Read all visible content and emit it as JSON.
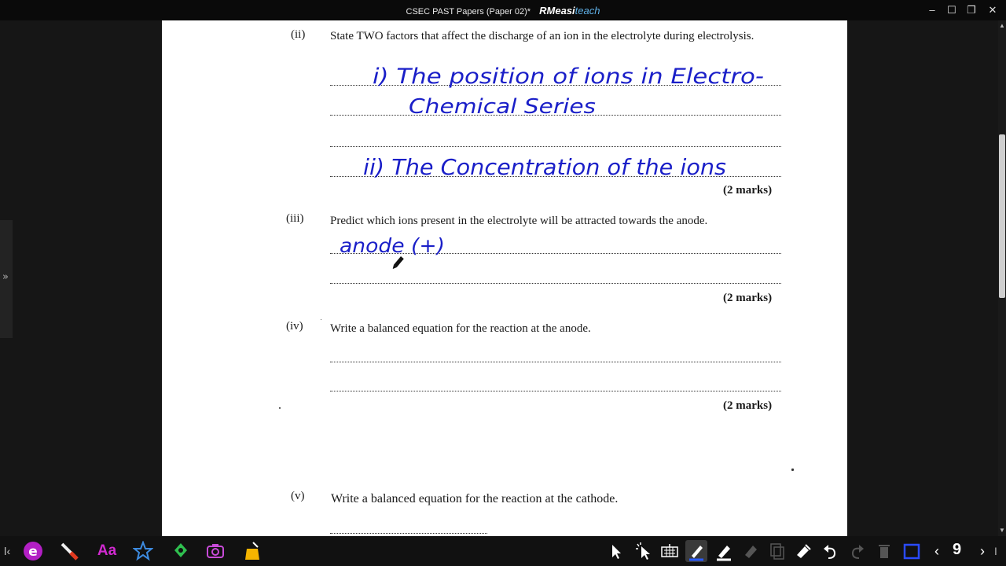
{
  "window": {
    "title": "CSEC PAST Papers (Paper 02)*",
    "brand_bold": "RMeasi",
    "brand_light": "teach",
    "minimize": "–",
    "maximize": "☐",
    "restore": "❐",
    "close": "✕"
  },
  "sidebar": {
    "handle_glyph": "»"
  },
  "paper": {
    "q2": {
      "num": "(ii)",
      "text": "State TWO factors that affect the discharge of an ion in the electrolyte during electrolysis.",
      "marks": "(2 marks)",
      "answer1_line1": "i) The position of ions in Electro-",
      "answer1_line2": "Chemical Series",
      "answer2": "ii) The Concentration of the ions"
    },
    "q3": {
      "num": "(iii)",
      "text": "Predict which ions present in the electrolyte will be attracted towards the anode.",
      "marks": "(2 marks)",
      "answer": "anode (+)"
    },
    "q4": {
      "num": "(iv)",
      "text": "Write a balanced equation for the reaction at the anode.",
      "marks": "(2 marks)"
    },
    "q5": {
      "num": "(v)",
      "text": "Write a balanced equation for the reaction at the cathode."
    }
  },
  "toolbar": {
    "left_arrow": "ǀ‹",
    "text_tool": "Aa",
    "page_number": "9",
    "icons": [
      "edge-icon",
      "marker-icon",
      "text-icon",
      "star-icon",
      "recycle-icon",
      "camera-icon",
      "shape-icon",
      "pointer-icon",
      "magic-pointer-icon",
      "keyboard-icon",
      "pen-icon",
      "highlighter-icon",
      "eraser-icon",
      "copy-icon",
      "fill-icon",
      "undo-icon",
      "redo-icon",
      "trash-icon",
      "rectangle-select-icon",
      "prev-page-icon",
      "next-page-icon"
    ],
    "accent": "#1a1fc8"
  }
}
